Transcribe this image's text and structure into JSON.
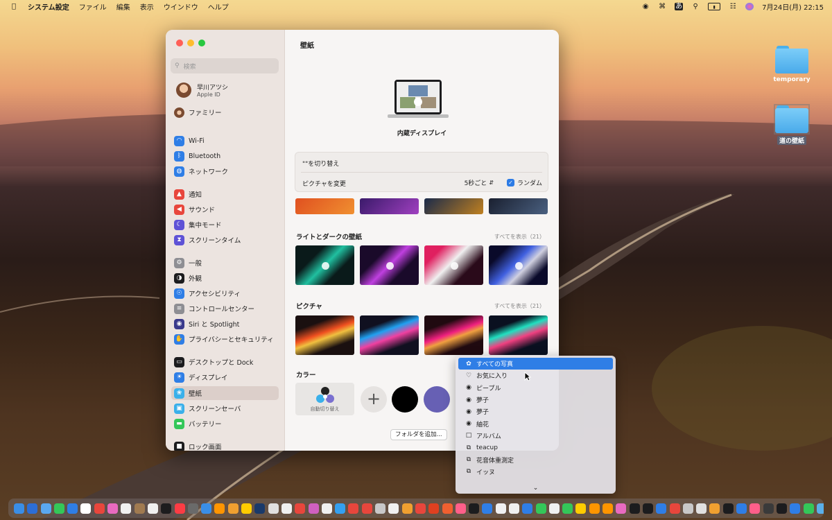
{
  "menubar": {
    "apple_icon": "apple-icon",
    "app_name": "システム設定",
    "menus": [
      "ファイル",
      "編集",
      "表示",
      "ウインドウ",
      "ヘルプ"
    ],
    "input_indicator": "あ",
    "datetime": "7月24日(月) 22:15"
  },
  "desktop": {
    "items": [
      {
        "label": "temporary"
      },
      {
        "label": "道の壁紙"
      }
    ]
  },
  "sidebar": {
    "search_placeholder": "検索",
    "profile": {
      "name": "早川アツシ",
      "sub": "Apple ID"
    },
    "family": "ファミリー",
    "items": [
      {
        "label": "Wi-Fi",
        "icon": "wifi-icon",
        "color": "#2f7ee6"
      },
      {
        "label": "Bluetooth",
        "icon": "bluetooth-icon",
        "color": "#2f7ee6"
      },
      {
        "label": "ネットワーク",
        "icon": "globe-icon",
        "color": "#2f7ee6"
      },
      {
        "label": "通知",
        "icon": "bell-icon",
        "color": "#e8463c"
      },
      {
        "label": "サウンド",
        "icon": "speaker-icon",
        "color": "#e8463c"
      },
      {
        "label": "集中モード",
        "icon": "moon-icon",
        "color": "#5e52d6"
      },
      {
        "label": "スクリーンタイム",
        "icon": "hourglass-icon",
        "color": "#5e52d6"
      },
      {
        "label": "一般",
        "icon": "gear-icon",
        "color": "#8e8e93"
      },
      {
        "label": "外観",
        "icon": "appearance-icon",
        "color": "#1c1c1e"
      },
      {
        "label": "アクセシビリティ",
        "icon": "accessibility-icon",
        "color": "#2f7ee6"
      },
      {
        "label": "コントロールセンター",
        "icon": "control-center-icon",
        "color": "#8e8e93"
      },
      {
        "label": "Siri と Spotlight",
        "icon": "siri-icon",
        "color": "#3a3a8c"
      },
      {
        "label": "プライバシーとセキュリティ",
        "icon": "hand-icon",
        "color": "#2f7ee6"
      },
      {
        "label": "デスクトップと Dock",
        "icon": "dock-icon",
        "color": "#1c1c1e"
      },
      {
        "label": "ディスプレイ",
        "icon": "display-icon",
        "color": "#2f7ee6"
      },
      {
        "label": "壁紙",
        "icon": "wallpaper-icon",
        "color": "#3ab0ea"
      },
      {
        "label": "スクリーンセーバ",
        "icon": "screensaver-icon",
        "color": "#3ab0ea"
      },
      {
        "label": "バッテリー",
        "icon": "battery-icon",
        "color": "#34c759"
      },
      {
        "label": "ロック画面",
        "icon": "lock-icon",
        "color": "#1c1c1e"
      }
    ],
    "selected": "壁紙"
  },
  "main": {
    "title": "壁紙",
    "display_label": "内蔵ディスプレイ",
    "rotate_label": "\"\"を切り替え",
    "change_picture_label": "ピクチャを変更",
    "interval_value": "5秒ごと",
    "random_label": "ランダム",
    "random_checked": true,
    "section_light_dark": {
      "title": "ライトとダークの壁紙",
      "show_all": "すべてを表示（21）"
    },
    "section_pictures": {
      "title": "ピクチャ",
      "show_all": "すべてを表示（21）"
    },
    "section_colors": {
      "title": "カラー",
      "auto_label": "自動切り替え"
    },
    "add_folder_button": "フォルダを追加..."
  },
  "dropdown": {
    "items": [
      {
        "label": "すべての写真",
        "icon": "photos-icon",
        "active": true
      },
      {
        "label": "お気に入り",
        "icon": "heart-icon"
      },
      {
        "label": "ピープル",
        "icon": "person-icon"
      },
      {
        "label": "夢子",
        "icon": "person-icon"
      },
      {
        "label": "夢子",
        "icon": "person-icon"
      },
      {
        "label": "紬花",
        "icon": "person-icon"
      },
      {
        "label": "アルバム",
        "icon": "album-icon"
      },
      {
        "label": "teacup",
        "icon": "album-stack-icon"
      },
      {
        "label": "花音体重測定",
        "icon": "album-stack-icon"
      },
      {
        "label": "イッヌ",
        "icon": "album-stack-icon"
      }
    ],
    "more_icon": "chevron-down-icon"
  },
  "colors": {
    "accent": "#2f7ee6",
    "swatch_black": "#000000",
    "swatch_purple": "#6760b4"
  }
}
